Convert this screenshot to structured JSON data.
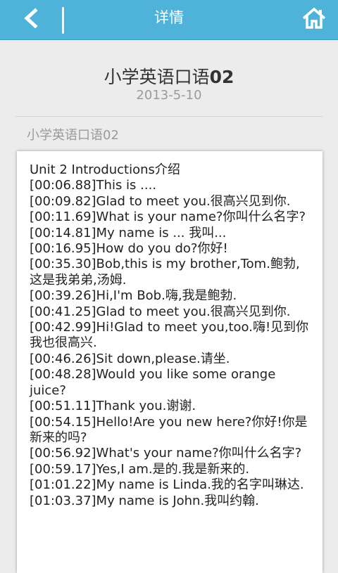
{
  "header": {
    "title": "详情",
    "back_icon": "back-arrow-icon",
    "home_icon": "home-icon",
    "bar_color": "#4fb3d9"
  },
  "article": {
    "title_text": "小学英语口语",
    "title_number": "02",
    "date": "2013-5-10",
    "category": "小学英语口语02"
  },
  "content": {
    "lines": [
      "Unit 2 Introductions介绍",
      "[00:06.88]This is ....",
      "[00:09.82]Glad to meet you.很高兴见到你.",
      "[00:11.69]What is your name?你叫什么名字?",
      "[00:14.81]My name is ... 我叫...",
      "[00:16.95]How do you do?你好!",
      "[00:35.30]Bob,this is my brother,Tom.鲍勃,这是我弟弟,汤姆.",
      "[00:39.26]Hi,I'm Bob.嗨,我是鲍勃.",
      "[00:41.25]Glad to meet you.很高兴见到你.",
      "[00:42.99]Hi!Glad to meet you,too.嗨!见到你我也很高兴.",
      "[00:46.26]Sit down,please.请坐.",
      "[00:48.28]Would you like some orange juice?",
      "[00:51.11]Thank you.谢谢.",
      "[00:54.15]Hello!Are you new here?你好!你是新来的吗?",
      "[00:56.92]What's your name?你叫什么名字?",
      "[00:59.17]Yes,I am.是的.我是新来的.",
      "[01:01.22]My name is Linda.我的名字叫琳达.",
      "[01:03.37]My name is John.我叫约翰."
    ]
  }
}
